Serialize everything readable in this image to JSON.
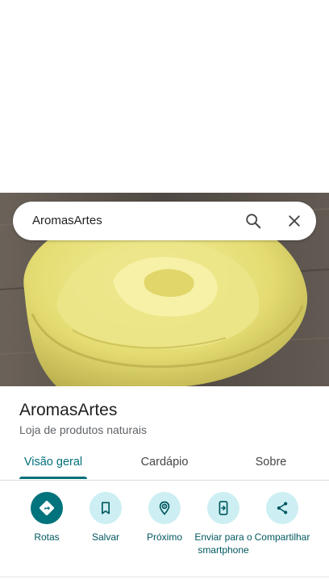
{
  "search": {
    "query": "AromasArtes"
  },
  "place": {
    "name": "AromasArtes",
    "category": "Loja de produtos naturais"
  },
  "tabs": [
    {
      "label": "Visão geral",
      "active": true
    },
    {
      "label": "Cardápio",
      "active": false
    },
    {
      "label": "Sobre",
      "active": false
    }
  ],
  "actions": [
    {
      "label": "Rotas",
      "icon": "directions-icon"
    },
    {
      "label": "Salvar",
      "icon": "bookmark-icon"
    },
    {
      "label": "Próximo",
      "icon": "nearby-icon"
    },
    {
      "label": "Enviar para o smartphone",
      "icon": "send-to-phone-icon"
    },
    {
      "label": "Compartilhar",
      "icon": "share-icon"
    }
  ],
  "colors": {
    "accent": "#00707a",
    "action_circle": "#cdeff3",
    "primary_circle": "#00737c"
  }
}
